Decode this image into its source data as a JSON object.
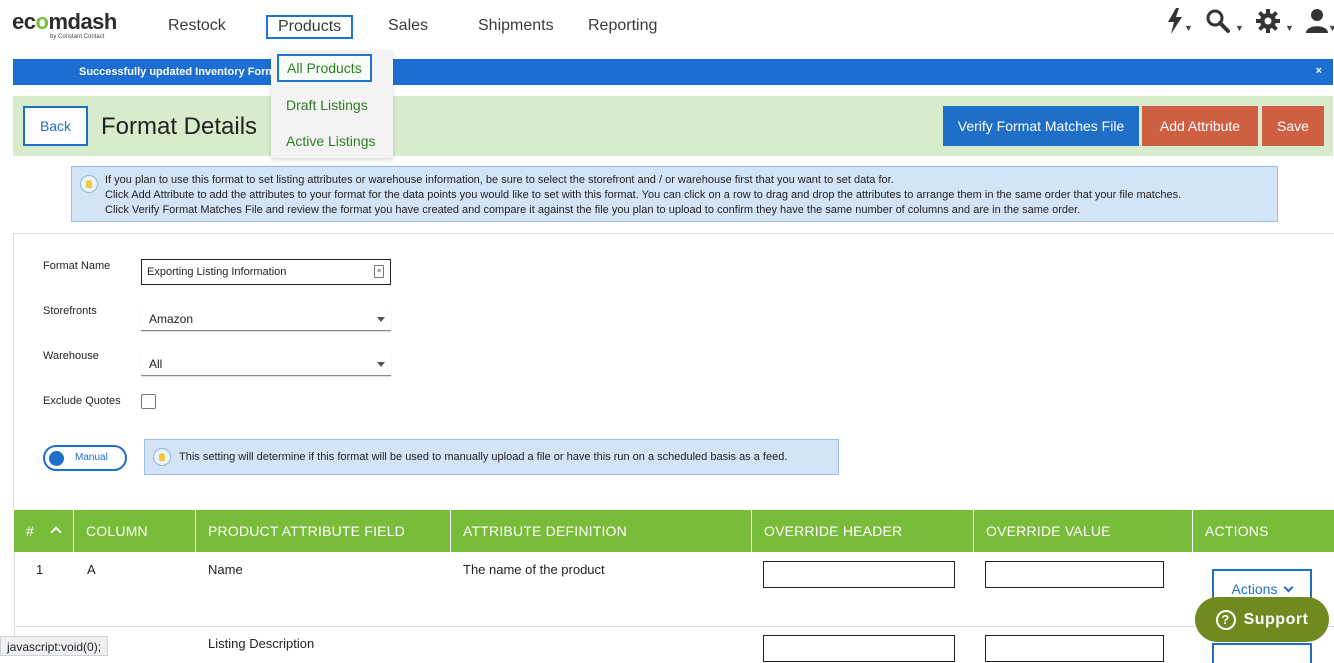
{
  "logo": {
    "brand": "ecomdash",
    "brand_prefix": "ec",
    "brand_accent": "o",
    "brand_suffix": "mdash",
    "sub": "by Constant Contact"
  },
  "nav": {
    "restock": "Restock",
    "products": "Products",
    "sales": "Sales",
    "shipments": "Shipments",
    "reporting": "Reporting"
  },
  "top_icons": [
    "lightning-icon",
    "search-icon",
    "gear-icon",
    "user-icon"
  ],
  "products_menu": {
    "all_products": "All Products",
    "draft_listings": "Draft Listings",
    "active_listings": "Active Listings"
  },
  "banner": {
    "text": "Successfully updated Inventory Form",
    "close": "×"
  },
  "header": {
    "back": "Back",
    "title": "Format Details",
    "verify": "Verify Format Matches File",
    "add_attribute": "Add Attribute",
    "save": "Save"
  },
  "info": {
    "line1": "If you plan to use this format to set listing attributes or warehouse information, be sure to select the storefront and / or warehouse first that you want to set data for.",
    "line2": "Click Add Attribute to add the attributes to your format for the data points you would like to set with this format. You can click on a row to drag and drop the attributes to arrange them in the same order that your file matches.",
    "line3": "Click Verify Format Matches File and review the format you have created and compare it against the file you plan to upload to confirm they have the same number of columns and are in the same order."
  },
  "form": {
    "format_name_label": "Format Name",
    "format_name_value": "Exporting Listing Information",
    "storefronts_label": "Storefronts",
    "storefronts_value": "Amazon",
    "warehouse_label": "Warehouse",
    "warehouse_value": "All",
    "exclude_quotes_label": "Exclude Quotes",
    "exclude_quotes_checked": false,
    "mode_toggle": "Manual",
    "mode_info": "This setting will determine if this format will be used to manually upload a file or have this run on a scheduled basis as a feed."
  },
  "table": {
    "headers": {
      "num": "#",
      "column": "COLUMN",
      "field": "PRODUCT ATTRIBUTE FIELD",
      "definition": "ATTRIBUTE DEFINITION",
      "override_header": "OVERRIDE HEADER",
      "override_value": "OVERRIDE VALUE",
      "actions": "ACTIONS"
    },
    "rows": [
      {
        "num": "1",
        "column": "A",
        "field": "Name",
        "definition": "The name of the product",
        "override_header": "",
        "override_value": "",
        "actions": "Actions"
      },
      {
        "num": "",
        "column": "",
        "field": "Listing Description",
        "definition": "",
        "override_header": "",
        "override_value": "",
        "actions": ""
      }
    ]
  },
  "support": {
    "label": "Support",
    "icon": "?"
  },
  "status_bar": "javascript:void(0);",
  "colors": {
    "brand_blue": "#1f6fc8",
    "brand_green": "#78bd3a",
    "save_red": "#cf5f43",
    "support_olive": "#6f8a1f"
  }
}
